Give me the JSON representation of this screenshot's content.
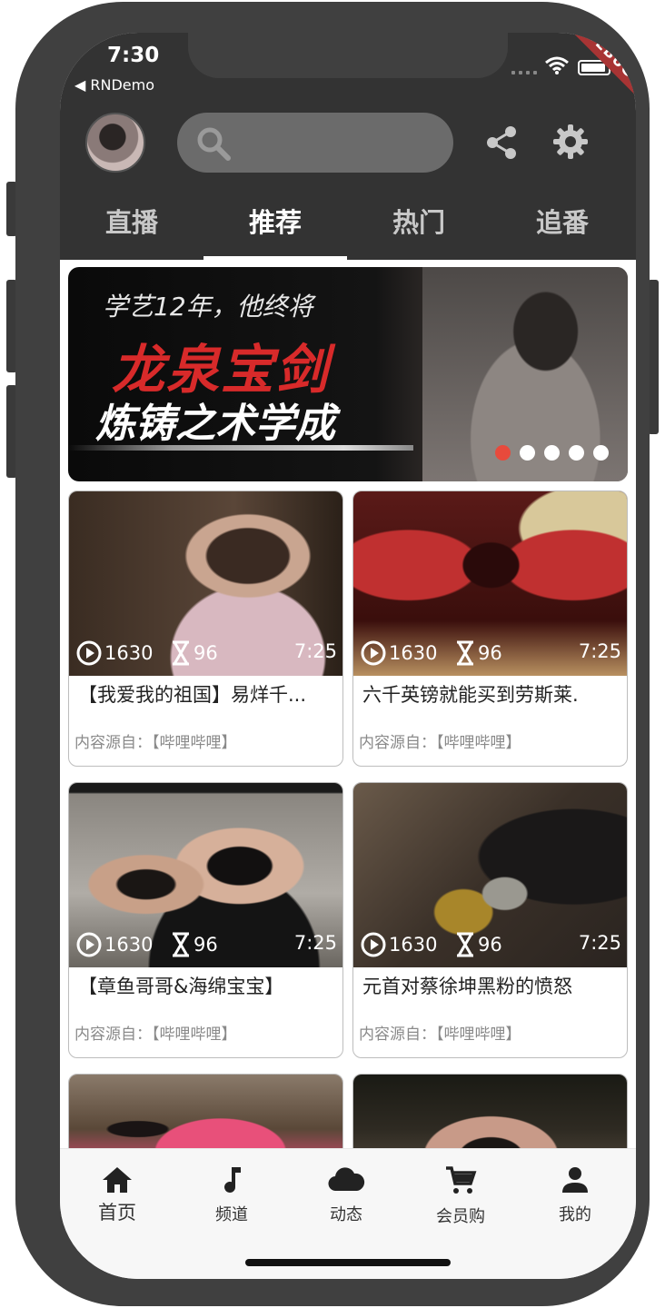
{
  "status_bar": {
    "time": "7:30",
    "back_app": "◀ RNDemo",
    "debug_label": "DEBUG"
  },
  "header": {
    "search_placeholder": "",
    "tabs": [
      {
        "label": "直播"
      },
      {
        "label": "推荐"
      },
      {
        "label": "热门"
      },
      {
        "label": "追番"
      }
    ],
    "active_tab": "推荐"
  },
  "banner": {
    "line1": "学艺12年，他终将",
    "line2": "龙泉宝剑",
    "line3": "炼铸之术学成",
    "pages": 5,
    "active_page": 1
  },
  "videos": [
    {
      "plays": "1630",
      "duration_count": "96",
      "length": "7:25",
      "title": "【我爱我的祖国】易烊千...",
      "source": "内容源自：【哔哩哔哩】"
    },
    {
      "plays": "1630",
      "duration_count": "96",
      "length": "7:25",
      "title": "六千英镑就能买到劳斯莱.",
      "source": "内容源自：【哔哩哔哩】"
    },
    {
      "plays": "1630",
      "duration_count": "96",
      "length": "7:25",
      "title": "【章鱼哥哥&海绵宝宝】",
      "source": "内容源自：【哔哩哔哩】"
    },
    {
      "plays": "1630",
      "duration_count": "96",
      "length": "7:25",
      "title": "元首对蔡徐坤黑粉的愤怒",
      "source": "内容源自：【哔哩哔哩】"
    }
  ],
  "bottom_nav": {
    "items": [
      {
        "label": "首页",
        "icon": "home-icon"
      },
      {
        "label": "频道",
        "icon": "music-note-icon"
      },
      {
        "label": "动态",
        "icon": "cloud-icon"
      },
      {
        "label": "会员购",
        "icon": "cart-icon"
      },
      {
        "label": "我的",
        "icon": "person-icon"
      }
    ],
    "active": "首页"
  },
  "colors": {
    "header_bg": "#333333",
    "accent_dot": "#e84a3c",
    "frame": "#404040"
  }
}
